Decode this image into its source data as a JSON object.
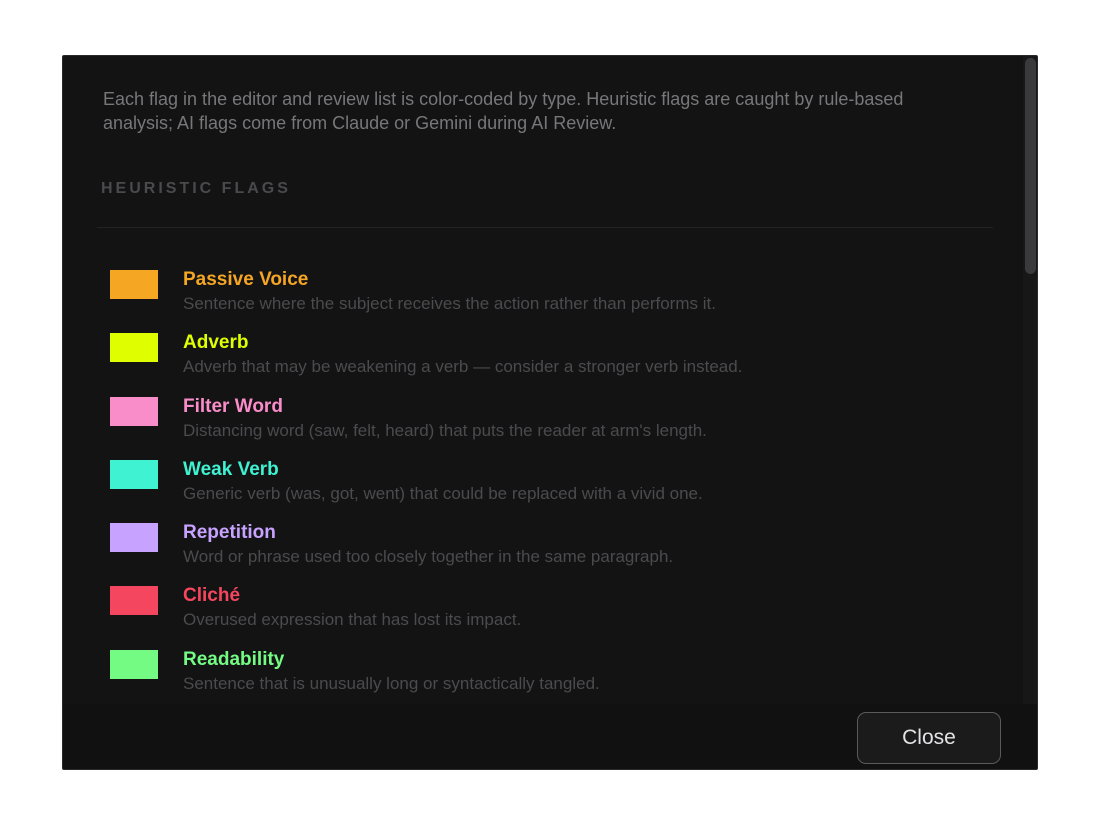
{
  "dialog": {
    "intro": "Each flag in the editor and review list is color-coded by type. Heuristic flags are caught by rule-based analysis; AI flags come from Claude or Gemini during AI Review.",
    "section_heading": "HEURISTIC FLAGS",
    "flags": [
      {
        "name": "Passive Voice",
        "description": "Sentence where the subject receives the action rather than performs it.",
        "color": "#f5a623"
      },
      {
        "name": "Adverb",
        "description": "Adverb that may be weakening a verb — consider a stronger verb instead.",
        "color": "#dfff00"
      },
      {
        "name": "Filter Word",
        "description": "Distancing word (saw, felt, heard) that puts the reader at arm's length.",
        "color": "#f98dc9"
      },
      {
        "name": "Weak Verb",
        "description": "Generic verb (was, got, went) that could be replaced with a vivid one.",
        "color": "#3ef2d2"
      },
      {
        "name": "Repetition",
        "description": "Word or phrase used too closely together in the same paragraph.",
        "color": "#c8a2ff"
      },
      {
        "name": "Cliché",
        "description": "Overused expression that has lost its impact.",
        "color": "#f5465f"
      },
      {
        "name": "Readability",
        "description": "Sentence that is unusually long or syntactically tangled.",
        "color": "#73fb84"
      }
    ],
    "close_label": "Close"
  }
}
